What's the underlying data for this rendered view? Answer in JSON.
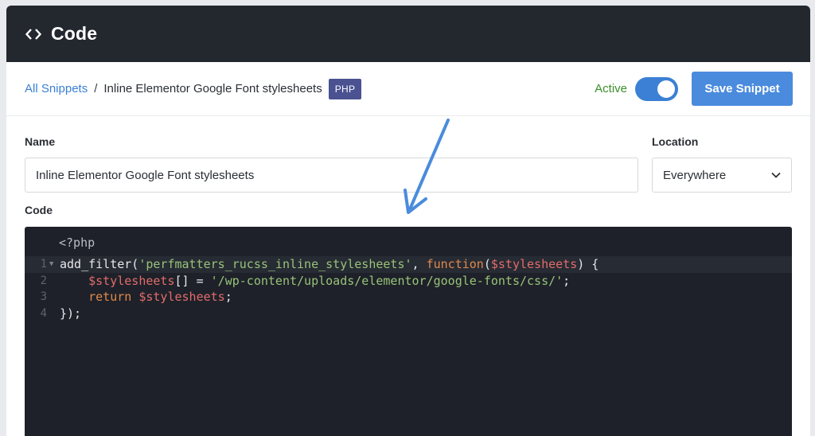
{
  "header": {
    "title": "Code",
    "icon": "code-brackets-icon"
  },
  "toolbar": {
    "breadcrumb_link": "All Snippets",
    "breadcrumb_sep": "/",
    "snippet_title": "Inline Elementor Google Font stylesheets",
    "language_badge": "PHP",
    "active_label": "Active",
    "active_on": true,
    "save_label": "Save Snippet"
  },
  "form": {
    "name_label": "Name",
    "name_value": "Inline Elementor Google Font stylesheets",
    "location_label": "Location",
    "location_value": "Everywhere",
    "code_label": "Code"
  },
  "editor": {
    "php_open": "<?php",
    "lines": [
      {
        "num": "1",
        "fold": "▼",
        "tokens": [
          {
            "t": "add_filter(",
            "c": "default"
          },
          {
            "t": "'perfmatters_rucss_inline_stylesheets'",
            "c": "str"
          },
          {
            "t": ", ",
            "c": "default"
          },
          {
            "t": "function",
            "c": "kw"
          },
          {
            "t": "(",
            "c": "default"
          },
          {
            "t": "$stylesheets",
            "c": "var"
          },
          {
            "t": ") {",
            "c": "default"
          }
        ]
      },
      {
        "num": "2",
        "fold": "",
        "tokens": [
          {
            "t": "    ",
            "c": "default"
          },
          {
            "t": "$stylesheets",
            "c": "var"
          },
          {
            "t": "[] = ",
            "c": "default"
          },
          {
            "t": "'/wp-content/uploads/elementor/google-fonts/css/'",
            "c": "str"
          },
          {
            "t": ";",
            "c": "default"
          }
        ]
      },
      {
        "num": "3",
        "fold": "",
        "tokens": [
          {
            "t": "    ",
            "c": "default"
          },
          {
            "t": "return",
            "c": "kw"
          },
          {
            "t": " ",
            "c": "default"
          },
          {
            "t": "$stylesheets",
            "c": "var"
          },
          {
            "t": ";",
            "c": "default"
          }
        ]
      },
      {
        "num": "4",
        "fold": "",
        "tokens": [
          {
            "t": "});",
            "c": "default"
          }
        ]
      }
    ]
  },
  "colors": {
    "header_bg": "#23272e",
    "accent": "#4a8bdd",
    "active_green": "#3a8f2a",
    "badge_bg": "#4a5291",
    "editor_bg": "#1e2129",
    "annotation_arrow": "#4a8bdd"
  }
}
